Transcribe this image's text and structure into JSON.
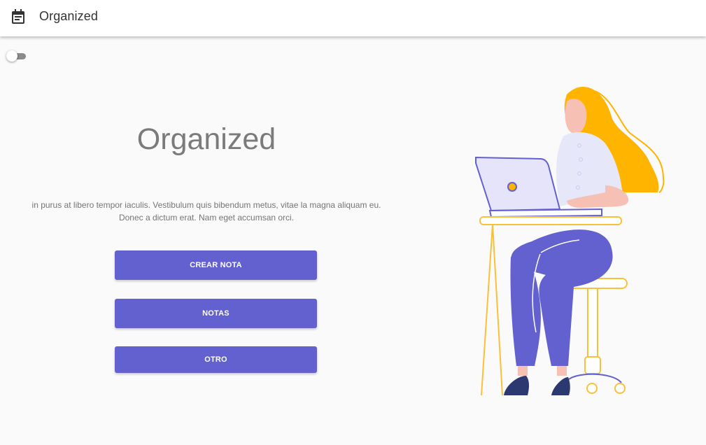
{
  "appbar": {
    "icon": "calendar-note-icon",
    "title": "Organized"
  },
  "toggle": {
    "state": "off"
  },
  "hero": {
    "title": "Organized",
    "text": "in purus at libero tempor iaculis. Vestibulum quis bibendum metus, vitae la magna aliquam eu. Donec a dictum erat. Nam eget accumsan orci."
  },
  "buttons": {
    "create_label": "CREAR NOTA",
    "notes_label": "NOTAS",
    "other_label": "OTRO"
  },
  "colors": {
    "accent": "#6360cf",
    "hair": "#ffb400",
    "desk": "#f9c13a",
    "background": "#fafafa"
  }
}
